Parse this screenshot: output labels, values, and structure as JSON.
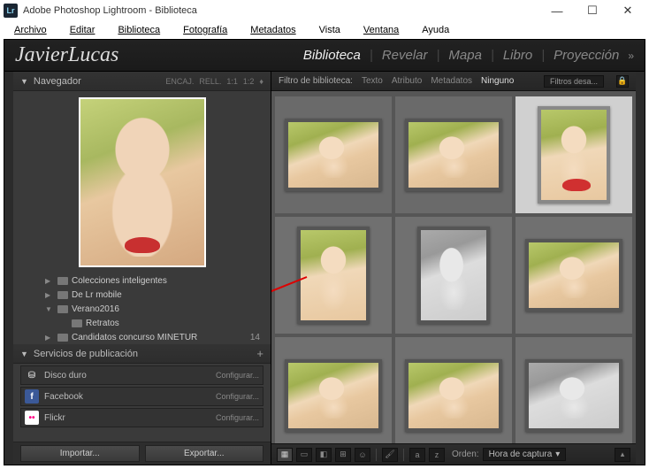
{
  "window": {
    "title": "Adobe Photoshop Lightroom - Biblioteca",
    "icon_label": "Lr"
  },
  "menu": [
    "Archivo",
    "Editar",
    "Biblioteca",
    "Fotografía",
    "Metadatos",
    "Vista",
    "Ventana",
    "Ayuda"
  ],
  "brand": "JavierLucas",
  "modules": {
    "items": [
      "Biblioteca",
      "Revelar",
      "Mapa",
      "Libro",
      "Proyección"
    ],
    "active_index": 0,
    "more": "»"
  },
  "navigator": {
    "title": "Navegador",
    "options": [
      "ENCAJ.",
      "RELL.",
      "1:1",
      "1:2"
    ],
    "tri": "▼"
  },
  "folders": [
    {
      "indent": 1,
      "tri": "▶",
      "label": "Colecciones inteligentes",
      "count": ""
    },
    {
      "indent": 1,
      "tri": "▶",
      "label": "De Lr mobile",
      "count": ""
    },
    {
      "indent": 1,
      "tri": "▼",
      "label": "Verano2016",
      "count": ""
    },
    {
      "indent": 2,
      "tri": "",
      "label": "Retratos",
      "count": ""
    },
    {
      "indent": 1,
      "tri": "▶",
      "label": "Candidatos concurso MINETUR",
      "count": "14"
    }
  ],
  "publish": {
    "title": "Servicios de publicación",
    "items": [
      {
        "icon_bg": "#555",
        "icon_fg": "#ccc",
        "glyph": "⛁",
        "label": "Disco duro",
        "action": "Configurar..."
      },
      {
        "icon_bg": "#3b5998",
        "icon_fg": "#fff",
        "glyph": "f",
        "label": "Facebook",
        "action": "Configurar..."
      },
      {
        "icon_bg": "#fff",
        "icon_fg": "#ff0084",
        "glyph": "••",
        "label": "Flickr",
        "action": "Configurar..."
      }
    ]
  },
  "bottom": {
    "import": "Importar...",
    "export": "Exportar..."
  },
  "filterbar": {
    "label": "Filtro de biblioteca:",
    "tabs": [
      "Texto",
      "Atributo",
      "Metadatos",
      "Ninguno"
    ],
    "active_index": 3,
    "preset": "Filtros desa...",
    "lock": "🔒"
  },
  "toolbar": {
    "sort_label": "Orden:",
    "sort_value": "Hora de captura",
    "sort_tri": "▾"
  }
}
